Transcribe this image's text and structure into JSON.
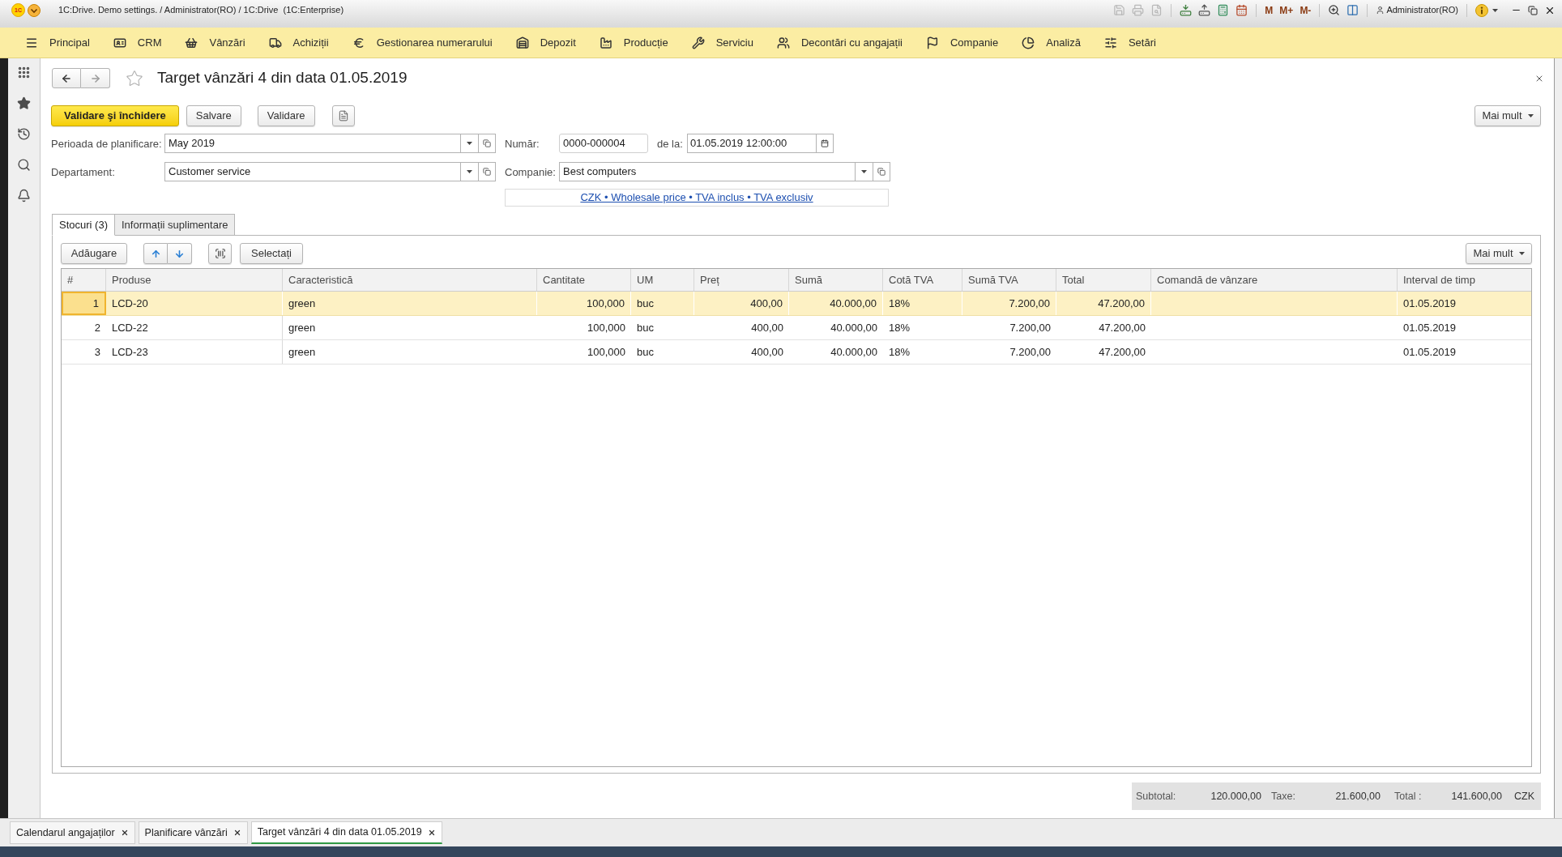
{
  "title_bar": {
    "logo": "1C",
    "title": "1C:Drive. Demo settings. / Administrator(RO) / 1C:Drive  (1C:Enterprise)",
    "memory_buttons": [
      "M",
      "M+",
      "M-"
    ],
    "user": "Administrator(RO)"
  },
  "main_menu": [
    "Principal",
    "CRM",
    "Vânzări",
    "Achiziții",
    "Gestionarea numerarului",
    "Depozit",
    "Producție",
    "Serviciu",
    "Decontări cu angajații",
    "Companie",
    "Analiză",
    "Setări"
  ],
  "document": {
    "title": "Target vânzări 4 din data 01.05.2019",
    "commands": [
      {
        "label": "Validare şi închidere",
        "kind": "primary"
      },
      {
        "label": "Salvare",
        "kind": "default"
      },
      {
        "label": "Validare",
        "kind": "default"
      }
    ],
    "more": "Mai mult",
    "fields": {
      "planning_period": {
        "label": "Perioada de planificare:",
        "value": "May 2019"
      },
      "number": {
        "label": "Număr:",
        "value": "0000-000004"
      },
      "date": {
        "label": "de la:",
        "value": "01.05.2019 12:00:00"
      },
      "department": {
        "label": "Departament:",
        "value": "Customer service"
      },
      "company": {
        "label": "Companie:",
        "value": "Best computers"
      }
    },
    "price_settings_link": "CZK • Wholesale price • TVA inclus • TVA exclusiv",
    "tabs": [
      {
        "label": "Stocuri (3)",
        "selected": true
      },
      {
        "label": "Informații suplimentare",
        "selected": false
      }
    ],
    "table_toolbar": {
      "add": "Adăugare",
      "select": "Selectați",
      "more": "Mai mult"
    },
    "table": {
      "columns": [
        "#",
        "Produse",
        "Caracteristică",
        "Cantitate",
        "UM",
        "Preț",
        "Sumă",
        "Cotă TVA",
        "Sumă TVA",
        "Total",
        "Comandă de vânzare",
        "Interval de timp"
      ],
      "rows": [
        {
          "number": "1",
          "product": "LCD-20",
          "characteristic": "green",
          "quantity": "100,000",
          "unit": "buc",
          "price": "400,00",
          "amount": "40.000,00",
          "vat_rate": "18%",
          "vat_amount": "7.200,00",
          "total": "47.200,00",
          "period": "01.05.2019",
          "selected": true
        },
        {
          "number": "2",
          "product": "LCD-22",
          "characteristic": "green",
          "quantity": "100,000",
          "unit": "buc",
          "price": "400,00",
          "amount": "40.000,00",
          "vat_rate": "18%",
          "vat_amount": "7.200,00",
          "total": "47.200,00",
          "period": "01.05.2019",
          "selected": false
        },
        {
          "number": "3",
          "product": "LCD-23",
          "characteristic": "green",
          "quantity": "100,000",
          "unit": "buc",
          "price": "400,00",
          "amount": "40.000,00",
          "vat_rate": "18%",
          "vat_amount": "7.200,00",
          "total": "47.200,00",
          "period": "01.05.2019",
          "selected": false
        }
      ]
    },
    "totals": {
      "subtotal_label": "Subtotal:",
      "subtotal": "120.000,00",
      "tax_label": "Taxe:",
      "tax": "21.600,00",
      "total_label": "Total :",
      "total": "141.600,00",
      "currency": "CZK"
    }
  },
  "open_windows": [
    {
      "label": "Calendarul angajaților",
      "selected": false
    },
    {
      "label": "Planificare vânzări",
      "selected": false
    },
    {
      "label": "Target vânzări 4 din data 01.05.2019",
      "selected": true
    }
  ]
}
